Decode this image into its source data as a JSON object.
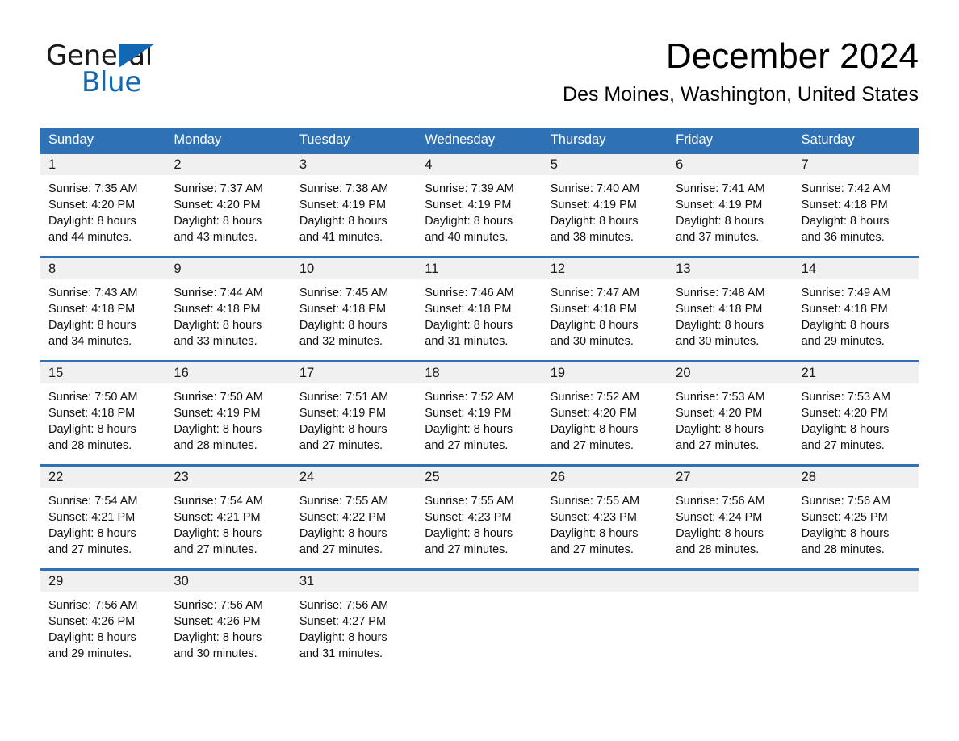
{
  "brand": {
    "name_part1": "General",
    "name_part2": "Blue",
    "logo_icon": "triangle-logo-icon",
    "accent_color": "#1268b3"
  },
  "header": {
    "month_title": "December 2024",
    "location": "Des Moines, Washington, United States"
  },
  "theme": {
    "header_blue": "#2e72b5",
    "daynum_band": "#f0f0f0",
    "row_border": "#2e72b5"
  },
  "calendar": {
    "weekdays": [
      "Sunday",
      "Monday",
      "Tuesday",
      "Wednesday",
      "Thursday",
      "Friday",
      "Saturday"
    ],
    "weeks": [
      [
        {
          "day": "1",
          "sunrise": "Sunrise: 7:35 AM",
          "sunset": "Sunset: 4:20 PM",
          "daylight_line1": "Daylight: 8 hours",
          "daylight_line2": "and 44 minutes."
        },
        {
          "day": "2",
          "sunrise": "Sunrise: 7:37 AM",
          "sunset": "Sunset: 4:20 PM",
          "daylight_line1": "Daylight: 8 hours",
          "daylight_line2": "and 43 minutes."
        },
        {
          "day": "3",
          "sunrise": "Sunrise: 7:38 AM",
          "sunset": "Sunset: 4:19 PM",
          "daylight_line1": "Daylight: 8 hours",
          "daylight_line2": "and 41 minutes."
        },
        {
          "day": "4",
          "sunrise": "Sunrise: 7:39 AM",
          "sunset": "Sunset: 4:19 PM",
          "daylight_line1": "Daylight: 8 hours",
          "daylight_line2": "and 40 minutes."
        },
        {
          "day": "5",
          "sunrise": "Sunrise: 7:40 AM",
          "sunset": "Sunset: 4:19 PM",
          "daylight_line1": "Daylight: 8 hours",
          "daylight_line2": "and 38 minutes."
        },
        {
          "day": "6",
          "sunrise": "Sunrise: 7:41 AM",
          "sunset": "Sunset: 4:19 PM",
          "daylight_line1": "Daylight: 8 hours",
          "daylight_line2": "and 37 minutes."
        },
        {
          "day": "7",
          "sunrise": "Sunrise: 7:42 AM",
          "sunset": "Sunset: 4:18 PM",
          "daylight_line1": "Daylight: 8 hours",
          "daylight_line2": "and 36 minutes."
        }
      ],
      [
        {
          "day": "8",
          "sunrise": "Sunrise: 7:43 AM",
          "sunset": "Sunset: 4:18 PM",
          "daylight_line1": "Daylight: 8 hours",
          "daylight_line2": "and 34 minutes."
        },
        {
          "day": "9",
          "sunrise": "Sunrise: 7:44 AM",
          "sunset": "Sunset: 4:18 PM",
          "daylight_line1": "Daylight: 8 hours",
          "daylight_line2": "and 33 minutes."
        },
        {
          "day": "10",
          "sunrise": "Sunrise: 7:45 AM",
          "sunset": "Sunset: 4:18 PM",
          "daylight_line1": "Daylight: 8 hours",
          "daylight_line2": "and 32 minutes."
        },
        {
          "day": "11",
          "sunrise": "Sunrise: 7:46 AM",
          "sunset": "Sunset: 4:18 PM",
          "daylight_line1": "Daylight: 8 hours",
          "daylight_line2": "and 31 minutes."
        },
        {
          "day": "12",
          "sunrise": "Sunrise: 7:47 AM",
          "sunset": "Sunset: 4:18 PM",
          "daylight_line1": "Daylight: 8 hours",
          "daylight_line2": "and 30 minutes."
        },
        {
          "day": "13",
          "sunrise": "Sunrise: 7:48 AM",
          "sunset": "Sunset: 4:18 PM",
          "daylight_line1": "Daylight: 8 hours",
          "daylight_line2": "and 30 minutes."
        },
        {
          "day": "14",
          "sunrise": "Sunrise: 7:49 AM",
          "sunset": "Sunset: 4:18 PM",
          "daylight_line1": "Daylight: 8 hours",
          "daylight_line2": "and 29 minutes."
        }
      ],
      [
        {
          "day": "15",
          "sunrise": "Sunrise: 7:50 AM",
          "sunset": "Sunset: 4:18 PM",
          "daylight_line1": "Daylight: 8 hours",
          "daylight_line2": "and 28 minutes."
        },
        {
          "day": "16",
          "sunrise": "Sunrise: 7:50 AM",
          "sunset": "Sunset: 4:19 PM",
          "daylight_line1": "Daylight: 8 hours",
          "daylight_line2": "and 28 minutes."
        },
        {
          "day": "17",
          "sunrise": "Sunrise: 7:51 AM",
          "sunset": "Sunset: 4:19 PM",
          "daylight_line1": "Daylight: 8 hours",
          "daylight_line2": "and 27 minutes."
        },
        {
          "day": "18",
          "sunrise": "Sunrise: 7:52 AM",
          "sunset": "Sunset: 4:19 PM",
          "daylight_line1": "Daylight: 8 hours",
          "daylight_line2": "and 27 minutes."
        },
        {
          "day": "19",
          "sunrise": "Sunrise: 7:52 AM",
          "sunset": "Sunset: 4:20 PM",
          "daylight_line1": "Daylight: 8 hours",
          "daylight_line2": "and 27 minutes."
        },
        {
          "day": "20",
          "sunrise": "Sunrise: 7:53 AM",
          "sunset": "Sunset: 4:20 PM",
          "daylight_line1": "Daylight: 8 hours",
          "daylight_line2": "and 27 minutes."
        },
        {
          "day": "21",
          "sunrise": "Sunrise: 7:53 AM",
          "sunset": "Sunset: 4:20 PM",
          "daylight_line1": "Daylight: 8 hours",
          "daylight_line2": "and 27 minutes."
        }
      ],
      [
        {
          "day": "22",
          "sunrise": "Sunrise: 7:54 AM",
          "sunset": "Sunset: 4:21 PM",
          "daylight_line1": "Daylight: 8 hours",
          "daylight_line2": "and 27 minutes."
        },
        {
          "day": "23",
          "sunrise": "Sunrise: 7:54 AM",
          "sunset": "Sunset: 4:21 PM",
          "daylight_line1": "Daylight: 8 hours",
          "daylight_line2": "and 27 minutes."
        },
        {
          "day": "24",
          "sunrise": "Sunrise: 7:55 AM",
          "sunset": "Sunset: 4:22 PM",
          "daylight_line1": "Daylight: 8 hours",
          "daylight_line2": "and 27 minutes."
        },
        {
          "day": "25",
          "sunrise": "Sunrise: 7:55 AM",
          "sunset": "Sunset: 4:23 PM",
          "daylight_line1": "Daylight: 8 hours",
          "daylight_line2": "and 27 minutes."
        },
        {
          "day": "26",
          "sunrise": "Sunrise: 7:55 AM",
          "sunset": "Sunset: 4:23 PM",
          "daylight_line1": "Daylight: 8 hours",
          "daylight_line2": "and 27 minutes."
        },
        {
          "day": "27",
          "sunrise": "Sunrise: 7:56 AM",
          "sunset": "Sunset: 4:24 PM",
          "daylight_line1": "Daylight: 8 hours",
          "daylight_line2": "and 28 minutes."
        },
        {
          "day": "28",
          "sunrise": "Sunrise: 7:56 AM",
          "sunset": "Sunset: 4:25 PM",
          "daylight_line1": "Daylight: 8 hours",
          "daylight_line2": "and 28 minutes."
        }
      ],
      [
        {
          "day": "29",
          "sunrise": "Sunrise: 7:56 AM",
          "sunset": "Sunset: 4:26 PM",
          "daylight_line1": "Daylight: 8 hours",
          "daylight_line2": "and 29 minutes."
        },
        {
          "day": "30",
          "sunrise": "Sunrise: 7:56 AM",
          "sunset": "Sunset: 4:26 PM",
          "daylight_line1": "Daylight: 8 hours",
          "daylight_line2": "and 30 minutes."
        },
        {
          "day": "31",
          "sunrise": "Sunrise: 7:56 AM",
          "sunset": "Sunset: 4:27 PM",
          "daylight_line1": "Daylight: 8 hours",
          "daylight_line2": "and 31 minutes."
        },
        {
          "day": "",
          "sunrise": "",
          "sunset": "",
          "daylight_line1": "",
          "daylight_line2": ""
        },
        {
          "day": "",
          "sunrise": "",
          "sunset": "",
          "daylight_line1": "",
          "daylight_line2": ""
        },
        {
          "day": "",
          "sunrise": "",
          "sunset": "",
          "daylight_line1": "",
          "daylight_line2": ""
        },
        {
          "day": "",
          "sunrise": "",
          "sunset": "",
          "daylight_line1": "",
          "daylight_line2": ""
        }
      ]
    ]
  }
}
